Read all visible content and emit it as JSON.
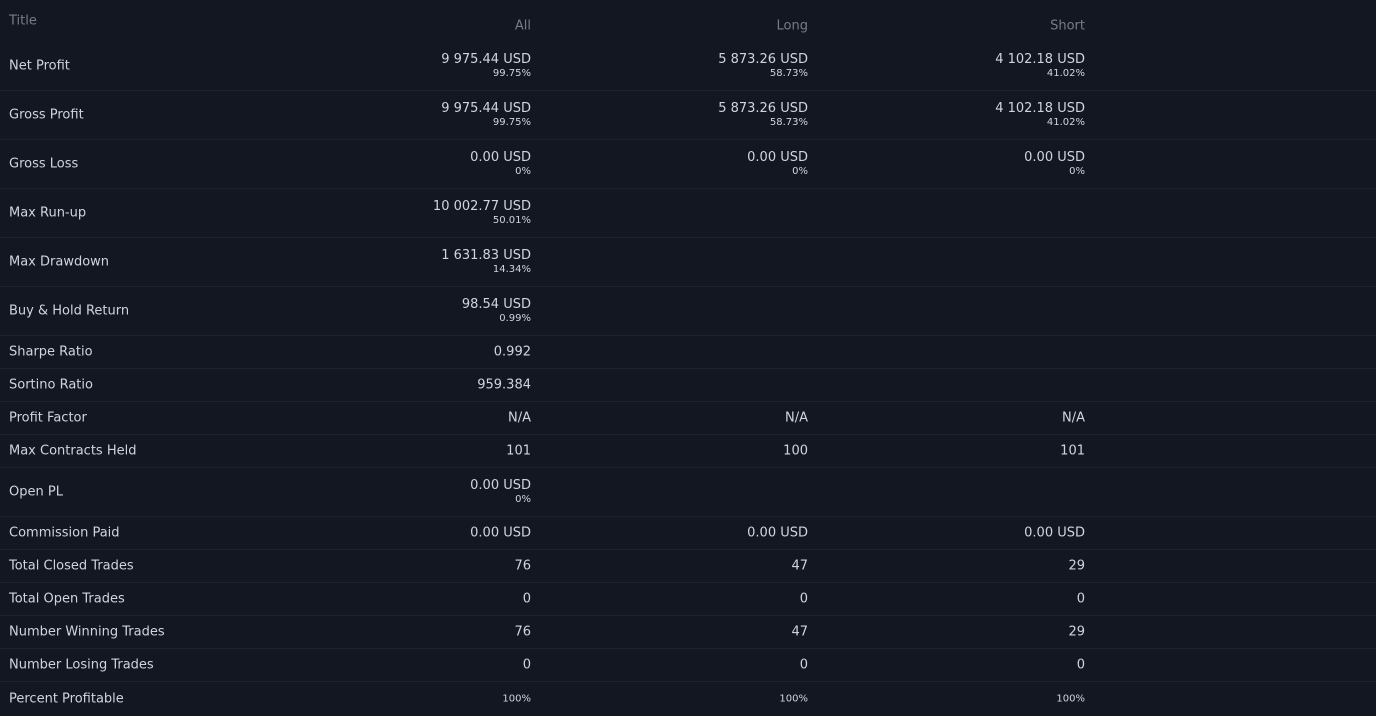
{
  "header": {
    "title": "Title",
    "all": "All",
    "long": "Long",
    "short": "Short"
  },
  "rows": [
    {
      "title": "Net Profit",
      "all": "9 975.44 USD",
      "all_sub": "99.75%",
      "long": "5 873.26 USD",
      "long_sub": "58.73%",
      "short": "4 102.18 USD",
      "short_sub": "41.02%"
    },
    {
      "title": "Gross Profit",
      "all": "9 975.44 USD",
      "all_sub": "99.75%",
      "long": "5 873.26 USD",
      "long_sub": "58.73%",
      "short": "4 102.18 USD",
      "short_sub": "41.02%"
    },
    {
      "title": "Gross Loss",
      "all": "0.00 USD",
      "all_sub": "0%",
      "long": "0.00 USD",
      "long_sub": "0%",
      "short": "0.00 USD",
      "short_sub": "0%"
    },
    {
      "title": "Max Run-up",
      "all": "10 002.77 USD",
      "all_sub": "50.01%"
    },
    {
      "title": "Max Drawdown",
      "all": "1 631.83 USD",
      "all_sub": "14.34%"
    },
    {
      "title": "Buy & Hold Return",
      "all": "98.54 USD",
      "all_sub": "0.99%"
    },
    {
      "title": "Sharpe Ratio",
      "all": "0.992"
    },
    {
      "title": "Sortino Ratio",
      "all": "959.384"
    },
    {
      "title": "Profit Factor",
      "all": "N/A",
      "long": "N/A",
      "short": "N/A"
    },
    {
      "title": "Max Contracts Held",
      "all": "101",
      "long": "100",
      "short": "101"
    },
    {
      "title": "Open PL",
      "all": "0.00 USD",
      "all_sub": "0%"
    },
    {
      "title": "Commission Paid",
      "all": "0.00 USD",
      "long": "0.00 USD",
      "short": "0.00 USD"
    },
    {
      "title": "Total Closed Trades",
      "all": "76",
      "long": "47",
      "short": "29"
    },
    {
      "title": "Total Open Trades",
      "all": "0",
      "long": "0",
      "short": "0"
    },
    {
      "title": "Number Winning Trades",
      "all": "76",
      "long": "47",
      "short": "29"
    },
    {
      "title": "Number Losing Trades",
      "all": "0",
      "long": "0",
      "short": "0"
    },
    {
      "title": "Percent Profitable",
      "all": "100%",
      "long": "100%",
      "short": "100%"
    }
  ]
}
